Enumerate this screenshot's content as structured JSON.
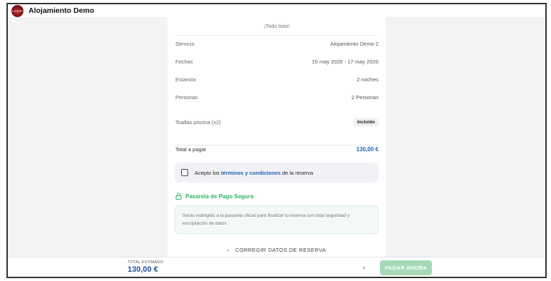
{
  "header": {
    "logo_text": "ALOJAMIENTO",
    "app_title": "Alojamiento Demo"
  },
  "summary": {
    "ready_text": "¡Todo listo!",
    "rows": [
      {
        "label": "Servicio",
        "value": "Alojamiento Demo 2"
      },
      {
        "label": "Fechas",
        "value": "15 may 2026 - 17 may 2026"
      },
      {
        "label": "Estancia",
        "value": "2 noches"
      },
      {
        "label": "Personas",
        "value": "2 Personas"
      }
    ],
    "extra": {
      "label": "Toallas piscina (x2)",
      "badge": "Incluido"
    },
    "total": {
      "label": "Total a pagar",
      "value": "130,00 €"
    }
  },
  "terms": {
    "prefix": "Acepto los",
    "link": "términos y condiciones",
    "suffix": "de la reserva"
  },
  "secure": {
    "title": "Pasarela de Pago Segura",
    "description": "Serás redirigido a la pasarela oficial para finalizar tu reserva con total seguridad y encriptación de datos."
  },
  "back": {
    "label": "CORREGIR DATOS DE RESERVA",
    "chevron": "‹"
  },
  "footer": {
    "estimate_label": "TOTAL ESTIMADO",
    "estimate_value": "130,00 €",
    "back_chevron": "‹",
    "pay_label": "PAGAR AHORA"
  },
  "colors": {
    "accent": "#1f5fb8",
    "secure": "#2fb463",
    "pay_disabled": "#a6d9b8"
  }
}
